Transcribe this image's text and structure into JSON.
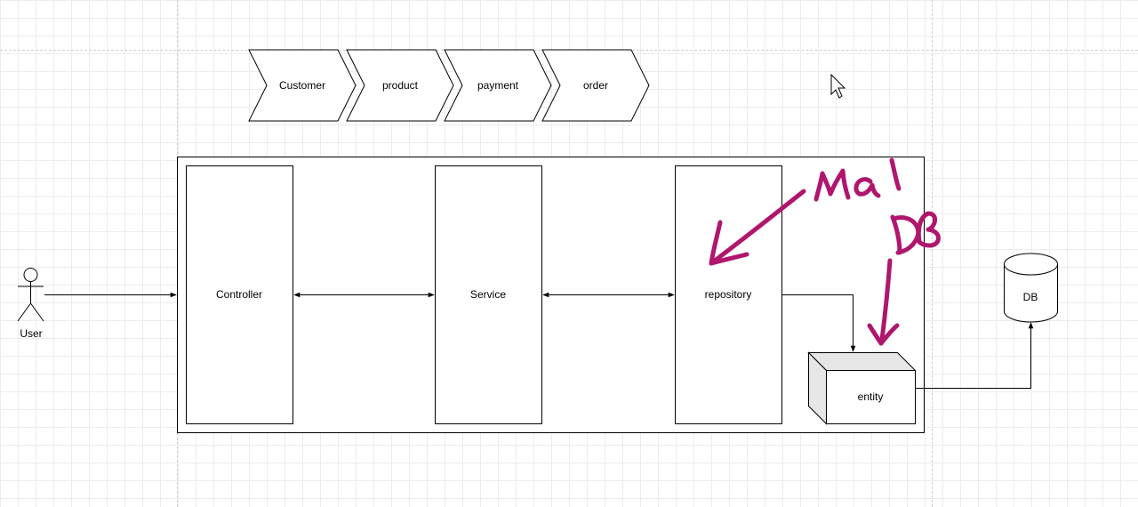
{
  "diagram": {
    "process_steps": [
      "Customer",
      "product",
      "payment",
      "order"
    ],
    "actor": {
      "label": "User"
    },
    "layers": {
      "controller": "Controller",
      "service": "Service",
      "repository": "repository"
    },
    "entity": "entity",
    "database": "DB",
    "annotations": {
      "handwritten_1": "Mal",
      "handwritten_2": "DB"
    },
    "colors": {
      "stroke": "#000000",
      "annotation": "#b0166e",
      "grid": "#ececec",
      "entity_side": "#e6e6e6"
    }
  }
}
